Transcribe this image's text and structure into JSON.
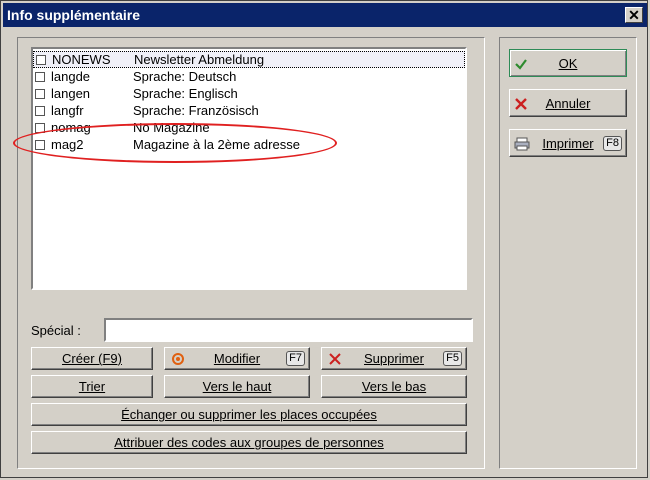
{
  "window": {
    "title": "Info supplémentaire",
    "close_glyph": "✕"
  },
  "list": {
    "items": [
      {
        "code": "NONEWS",
        "description": "Newsletter Abmeldung",
        "checked": false,
        "selected": true
      },
      {
        "code": "langde",
        "description": "Sprache: Deutsch",
        "checked": false
      },
      {
        "code": "langen",
        "description": "Sprache: Englisch",
        "checked": false
      },
      {
        "code": "langfr",
        "description": "Sprache: Französisch",
        "checked": false
      },
      {
        "code": "nomag",
        "description": "No Magazine",
        "checked": false
      },
      {
        "code": "mag2",
        "description": "Magazine à la 2ème adresse",
        "checked": false
      }
    ]
  },
  "special": {
    "label": "Spécial :",
    "value": ""
  },
  "buttons": {
    "create": "Créer (F9)",
    "modify": "Modifier",
    "modify_key": "F7",
    "delete": "Supprimer",
    "delete_key": "F5",
    "sort": "Trier",
    "up": "Vers le haut",
    "down": "Vers le bas",
    "exchange": "Échanger ou supprimer les places occupées",
    "assign": "Attribuer des codes aux groupes de personnes",
    "ok": "OK",
    "cancel": "Annuler",
    "print": "Imprimer",
    "print_key": "F8"
  },
  "colors": {
    "titlebar": "#0a246a",
    "highlight_ellipse": "#e02020",
    "ok_check": "#2e8b2e",
    "cancel_x": "#cc2020"
  },
  "icons": {
    "ok": "checkmark-icon",
    "cancel": "red-x-icon",
    "print": "printer-icon",
    "modify": "modify-circle-icon",
    "delete": "delete-x-icon"
  }
}
